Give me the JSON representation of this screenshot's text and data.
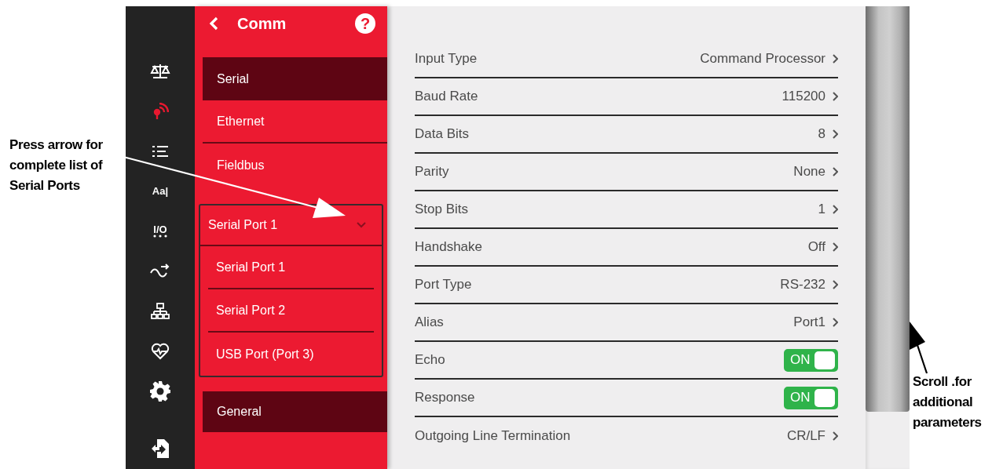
{
  "annotations": {
    "left": "Press arrow for complete list of Serial Ports",
    "right": "Scroll .for additional parameters"
  },
  "rail": [
    {
      "kind": "scale",
      "selected": false
    },
    {
      "kind": "signal",
      "selected": true
    },
    {
      "kind": "list",
      "selected": false
    },
    {
      "kind": "text",
      "label": "Aa|",
      "selected": false
    },
    {
      "kind": "io",
      "label": "I/O",
      "selected": false
    },
    {
      "kind": "wave",
      "selected": false
    },
    {
      "kind": "network",
      "selected": false
    },
    {
      "kind": "heart",
      "selected": false
    },
    {
      "kind": "gear",
      "selected": false
    },
    {
      "kind": "export",
      "selected": false
    }
  ],
  "panel": {
    "title": "Comm",
    "help": "?",
    "items": [
      {
        "label": "Serial",
        "selected": true
      },
      {
        "label": "Ethernet",
        "selected": false
      },
      {
        "label": "Fieldbus",
        "selected": false
      }
    ],
    "port_select": {
      "value": "Serial Port 1",
      "expanded": true,
      "options": [
        "Serial Port 1",
        "Serial Port 2",
        "USB Port (Port 3)"
      ]
    },
    "footer_item": {
      "label": "General",
      "selected": true
    }
  },
  "settings": [
    {
      "kind": "select",
      "label": "Input Type",
      "value": "Command Processor"
    },
    {
      "kind": "select",
      "label": "Baud Rate",
      "value": "115200"
    },
    {
      "kind": "select",
      "label": "Data Bits",
      "value": "8"
    },
    {
      "kind": "select",
      "label": "Parity",
      "value": "None"
    },
    {
      "kind": "select",
      "label": "Stop Bits",
      "value": "1"
    },
    {
      "kind": "select",
      "label": "Handshake",
      "value": "Off"
    },
    {
      "kind": "select",
      "label": "Port Type",
      "value": "RS-232"
    },
    {
      "kind": "select",
      "label": "Alias",
      "value": "Port1"
    },
    {
      "kind": "toggle",
      "label": "Echo",
      "value": "ON",
      "on": true
    },
    {
      "kind": "toggle",
      "label": "Response",
      "value": "ON",
      "on": true
    },
    {
      "kind": "select",
      "label": "Outgoing Line Termination",
      "value": "CR/LF"
    }
  ]
}
